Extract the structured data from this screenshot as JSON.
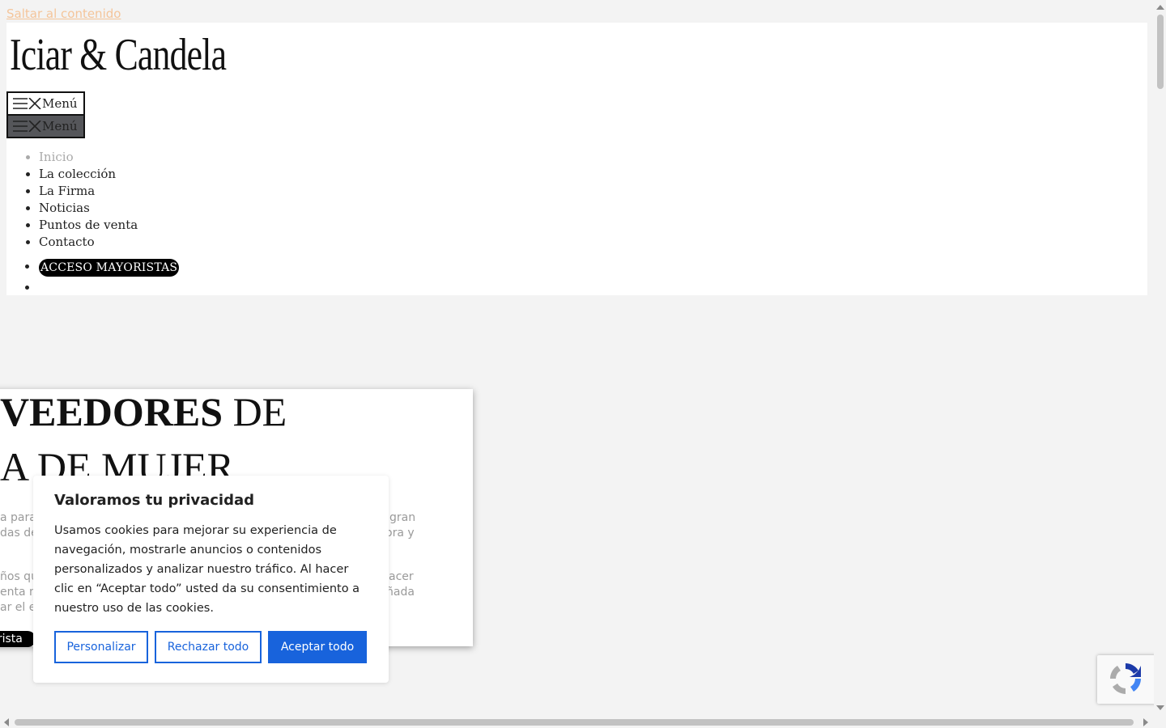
{
  "skip_link": "Saltar al contenido",
  "logo": "Iciar & Candela",
  "menu_buttons": [
    "Menú",
    "Menú"
  ],
  "nav": {
    "items": [
      "Inicio",
      "La colección",
      "La Firma",
      "Noticias",
      "Puntos de venta",
      "Contacto"
    ],
    "cta": "ACCESO MAYORISTAS"
  },
  "hero": {
    "line1_bold": "VEEDORES",
    "line1_rest": " DE",
    "line2": "A DE MUJER",
    "para_left": [
      "a para",
      "das de",
      "ños qu",
      "enta m",
      "ar el e"
    ],
    "para_right": [
      "gran",
      "ora y",
      "acer",
      "ñada"
    ],
    "button": "yorista"
  },
  "cookie": {
    "title": "Valoramos tu privacidad",
    "text": "Usamos cookies para mejorar su experiencia de navegación, mostrarle anuncios o contenidos personalizados y analizar nuestro tráfico. Al hacer clic en “Aceptar todo” usted da su consentimiento a nuestro uso de las cookies.",
    "buttons": {
      "customize": "Personalizar",
      "reject": "Rechazar todo",
      "accept": "Aceptar todo"
    },
    "accent_color": "#1863dc"
  },
  "icons": [
    "hamburger-icon",
    "close-icon",
    "recaptcha-icon"
  ]
}
